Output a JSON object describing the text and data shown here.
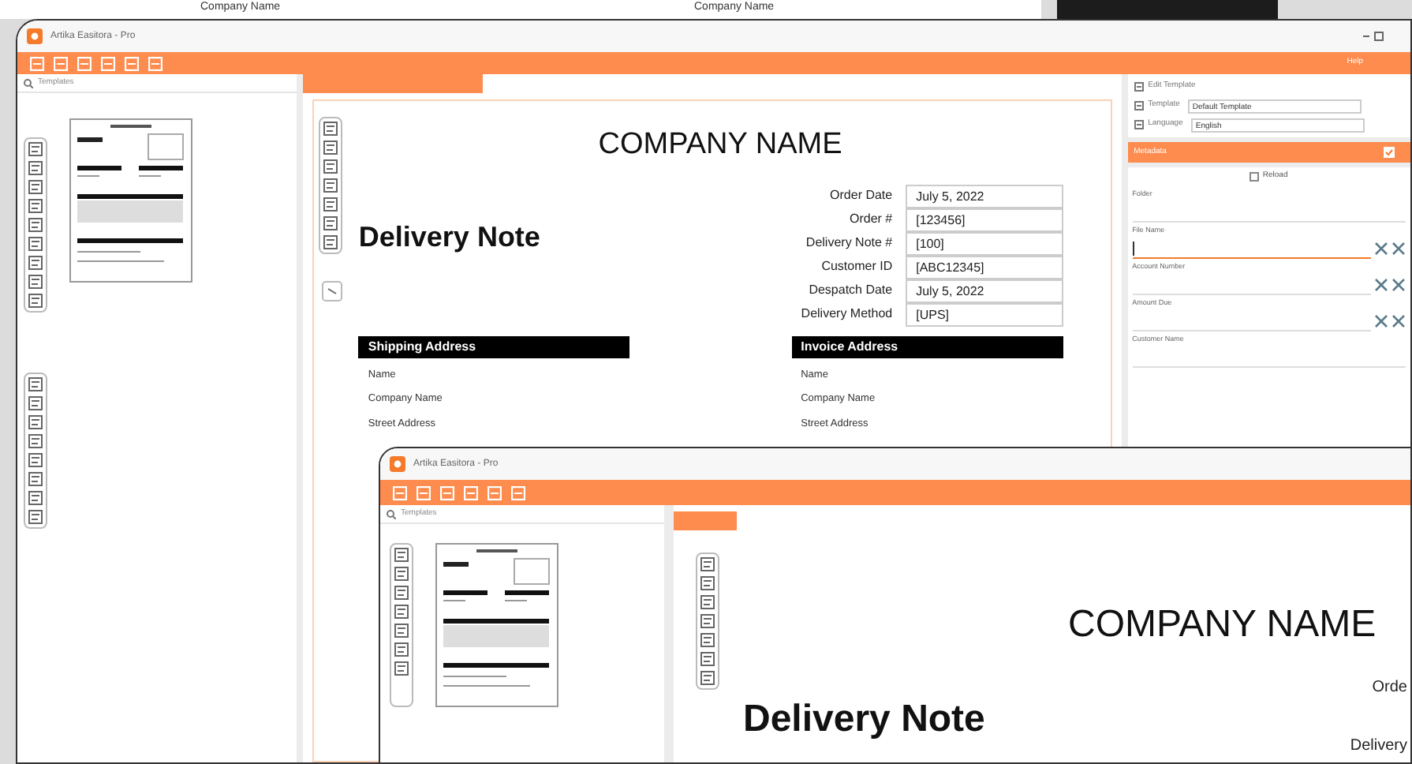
{
  "background_document": {
    "texts": [
      "Company Name",
      "Company Name"
    ]
  },
  "main_window": {
    "title": "Artika Easitora - Pro",
    "toolbar_label": "Help",
    "templates_panel": {
      "title": "Templates"
    },
    "document": {
      "company": "COMPANY NAME",
      "heading": "Delivery Note",
      "fields": [
        {
          "label": "Order Date",
          "value": "July 5, 2022"
        },
        {
          "label": "Order #",
          "value": "[123456]"
        },
        {
          "label": "Delivery Note #",
          "value": "[100]"
        },
        {
          "label": "Customer ID",
          "value": "[ABC12345]"
        },
        {
          "label": "Despatch Date",
          "value": "July 5, 2022"
        },
        {
          "label": "Delivery Method",
          "value": "[UPS]"
        }
      ],
      "addresses": [
        {
          "title": "Shipping Address",
          "lines": [
            "Name",
            "Company Name",
            "Street Address"
          ]
        },
        {
          "title": "Invoice Address",
          "lines": [
            "Name",
            "Company Name",
            "Street Address"
          ]
        }
      ]
    },
    "properties": {
      "rows": [
        {
          "label": "Edit Template"
        },
        {
          "label": "Template",
          "value": "Default Template"
        },
        {
          "label": "Language",
          "value": "English"
        }
      ],
      "section": {
        "title": "Metadata",
        "expanded": true
      },
      "reload": {
        "label": "Reload",
        "checked": false
      },
      "fields": [
        {
          "label": "Folder",
          "kind": "plain",
          "focused": false
        },
        {
          "label": "File Name",
          "kind": "tools",
          "focused": true
        },
        {
          "label": "Account Number",
          "kind": "tools",
          "focused": false
        },
        {
          "label": "Amount Due",
          "kind": "tools",
          "focused": false
        },
        {
          "label": "Customer Name",
          "kind": "plain",
          "focused": false
        }
      ]
    }
  },
  "front_window": {
    "title": "Artika Easitora - Pro",
    "templates_panel": {
      "title": "Templates"
    },
    "document": {
      "company": "COMPANY NAME",
      "heading": "Delivery Note",
      "labels": [
        "Orde",
        "Delivery"
      ]
    }
  }
}
